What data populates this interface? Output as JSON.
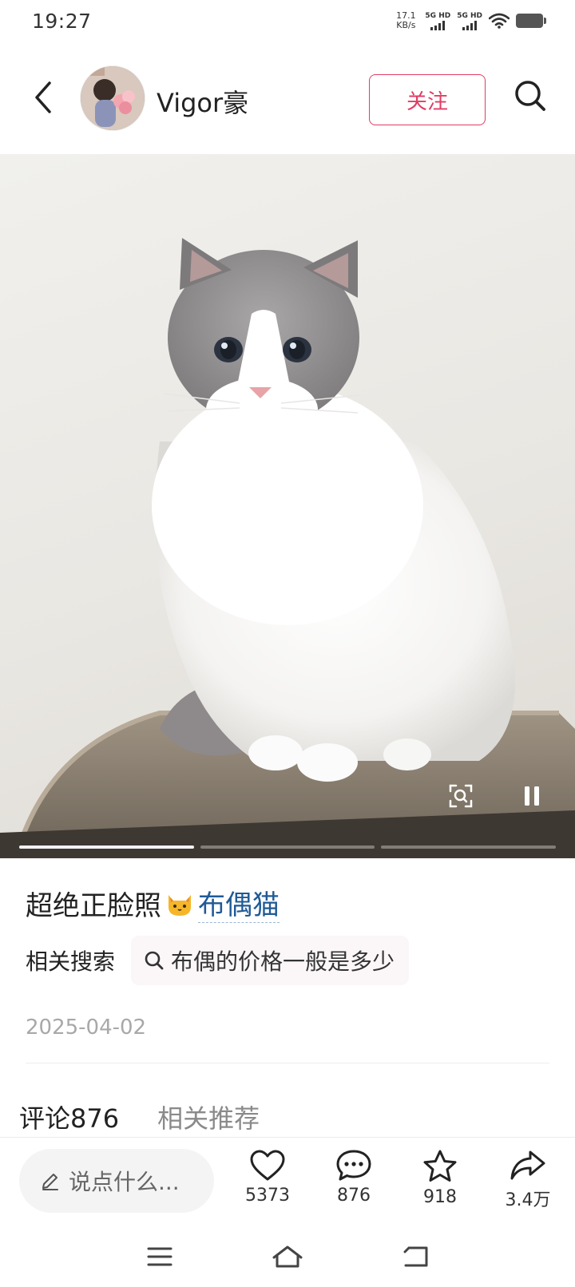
{
  "status_bar": {
    "time": "19:27",
    "net_speed_value": "17.1",
    "net_speed_unit": "KB/s",
    "signal_1": "5G HD",
    "signal_2": "5G HD",
    "icons": [
      "signal-icon",
      "signal-icon",
      "wifi-icon",
      "battery-icon"
    ]
  },
  "header": {
    "username": "Vigor豪",
    "follow_label": "关注",
    "icons": [
      "back-arrow-icon",
      "search-icon"
    ]
  },
  "media": {
    "image_subject": "ragdoll-cat-photo",
    "page_count": 3,
    "current_page": 1,
    "icons": [
      "text-recognition-icon",
      "pause-icon"
    ]
  },
  "post": {
    "title": "超绝正脸照",
    "emoji": "cat-face-icon",
    "topic_tag": "布偶猫",
    "related_label": "相关搜索",
    "related_query": "布偶的价格一般是多少",
    "date": "2025-04-02"
  },
  "tabs": [
    {
      "label": "评论876",
      "active": true
    },
    {
      "label": "相关推荐",
      "active": false
    }
  ],
  "action_bar": {
    "comment_placeholder": "说点什么...",
    "like_count": "5373",
    "comment_count": "876",
    "favorite_count": "918",
    "share_count": "3.4万",
    "icons": [
      "pencil-icon",
      "heart-icon",
      "comment-bubble-icon",
      "star-icon",
      "share-arrow-icon"
    ]
  },
  "nav_bar": {
    "icons": [
      "menu-icon",
      "home-icon",
      "back-icon"
    ]
  },
  "colors": {
    "accent": "#e23c64",
    "tag_blue": "#1f5a96",
    "date_gray": "#a8a8a8"
  }
}
